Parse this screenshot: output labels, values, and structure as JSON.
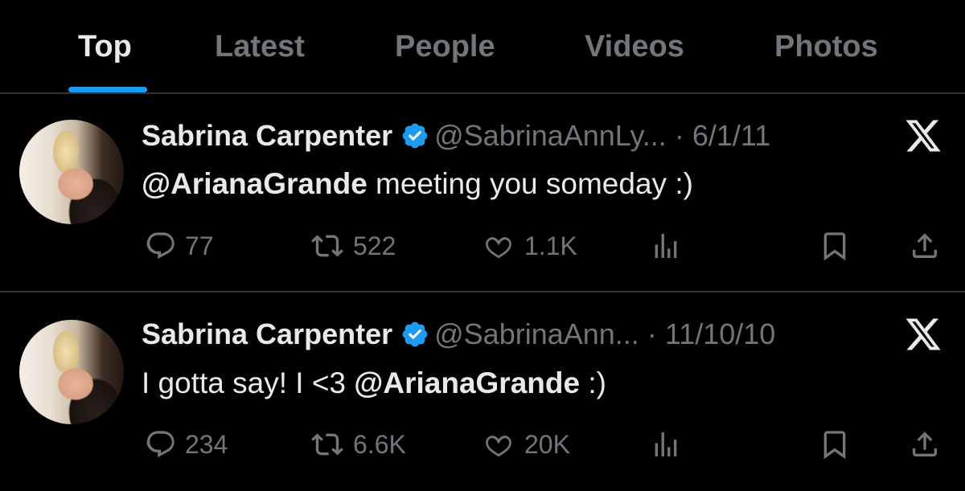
{
  "tabs": [
    {
      "label": "Top"
    },
    {
      "label": "Latest"
    },
    {
      "label": "People"
    },
    {
      "label": "Videos"
    },
    {
      "label": "Photos"
    }
  ],
  "tweets": [
    {
      "name": "Sabrina Carpenter",
      "handle": "@SabrinaAnnLy...",
      "separator": "·",
      "date": "6/1/11",
      "mention": "@ArianaGrande",
      "text_after": " meeting you someday :)",
      "text_before": "",
      "replies": "77",
      "reposts": "522",
      "likes": "1.1K"
    },
    {
      "name": "Sabrina Carpenter",
      "handle": "@SabrinaAnn...",
      "separator": "·",
      "date": "11/10/10",
      "text_before": "I gotta say! I <3 ",
      "mention": "@ArianaGrande",
      "text_after": " :)",
      "replies": "234",
      "reposts": "6.6K",
      "likes": "20K"
    }
  ],
  "colors": {
    "accent": "#1d9bf0",
    "muted": "#71767b",
    "text": "#e7e9ea",
    "background": "#000000"
  },
  "icons": {
    "verified": "verified-badge-icon",
    "x": "x-logo-icon",
    "reply": "reply-icon",
    "repost": "repost-icon",
    "like": "heart-icon",
    "views": "views-icon",
    "bookmark": "bookmark-icon",
    "share": "share-icon"
  }
}
